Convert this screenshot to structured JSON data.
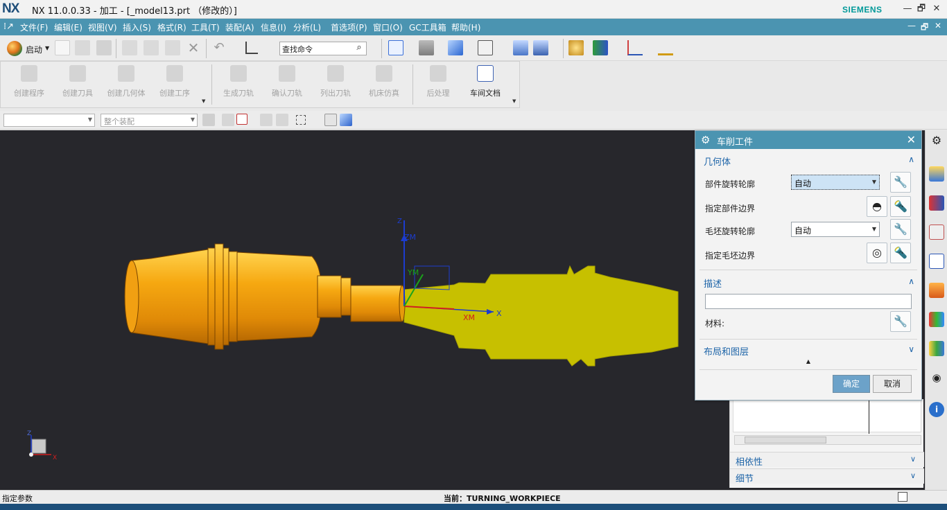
{
  "window": {
    "logo": "NX",
    "title": "NX 11.0.0.33 - 加工 - [_model13.prt （修改的）]",
    "brand": "SIEMENS",
    "minimize": "—",
    "restore": "🗗",
    "close": "✕"
  },
  "menu": {
    "items": [
      "文件(F)",
      "编辑(E)",
      "视图(V)",
      "插入(S)",
      "格式(R)",
      "工具(T)",
      "装配(A)",
      "信息(I)",
      "分析(L)",
      "首选项(P)",
      "窗口(O)",
      "GC工具箱",
      "帮助(H)"
    ],
    "minimize": "—",
    "restore": "🗗",
    "close": "✕"
  },
  "toolbar": {
    "start_label": "启动",
    "find_placeholder": "查找命令"
  },
  "ribbon": {
    "buttons": [
      "创建程序",
      "创建刀具",
      "创建几何体",
      "创建工序",
      "生成刀轨",
      "确认刀轨",
      "列出刀轨",
      "机床仿真",
      "后处理",
      "车间文档"
    ]
  },
  "selection_bar": {
    "filter_value": "",
    "scope_value": "整个装配"
  },
  "viewport": {
    "csys_labels": {
      "zm": "ZM",
      "ym": "YM",
      "xm": "XM",
      "z": "Z",
      "x": "X"
    },
    "triad_labels": {
      "z": "Z",
      "x": "X"
    }
  },
  "dialog": {
    "title": "车削工件",
    "geometry_section": "几何体",
    "part_profile_label": "部件旋转轮廓",
    "part_profile_value": "自动",
    "part_boundary_label": "指定部件边界",
    "blank_profile_label": "毛坯旋转轮廓",
    "blank_profile_value": "自动",
    "blank_boundary_label": "指定毛坯边界",
    "description_section": "描述",
    "description_value": "",
    "material_label": "材料:",
    "layout_section": "布局和图层",
    "ok_label": "确定",
    "cancel_label": "取消"
  },
  "nav_panel": {
    "dependency_label": "相依性",
    "details_label": "细节"
  },
  "status": {
    "left": "指定参数",
    "current": "当前：TURNING_WORKPIECE"
  },
  "colors": {
    "menubar": "#4b94b1",
    "part": "#f4a412",
    "blank": "#c7c000",
    "viewport_bg": "#27272c",
    "accent_text": "#1d64a8"
  }
}
